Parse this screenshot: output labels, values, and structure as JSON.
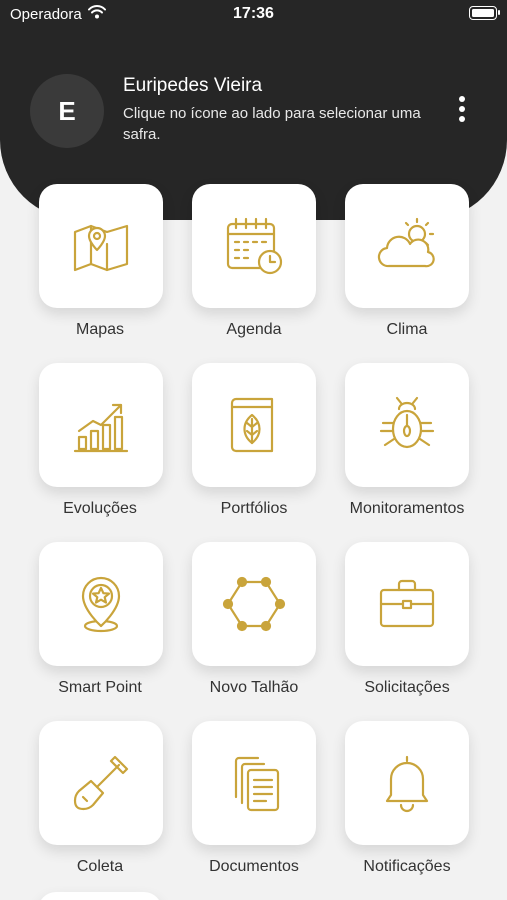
{
  "status_bar": {
    "carrier": "Operadora",
    "time": "17:36",
    "icons": [
      "wifi-icon",
      "battery-icon"
    ]
  },
  "header": {
    "avatar_initial": "E",
    "user_name": "Euripedes Vieira",
    "hint": "Clique no ícone ao lado para selecionar uma safra.",
    "menu_icon": "more-vertical-icon"
  },
  "accent_color": "#C9A43B",
  "menu": [
    {
      "label": "Mapas",
      "icon": "map-pin-icon"
    },
    {
      "label": "Agenda",
      "icon": "calendar-clock-icon"
    },
    {
      "label": "Clima",
      "icon": "weather-icon"
    },
    {
      "label": "Evoluções",
      "icon": "growth-chart-icon"
    },
    {
      "label": "Portfólios",
      "icon": "leaf-book-icon"
    },
    {
      "label": "Monitoramentos",
      "icon": "bug-icon"
    },
    {
      "label": "Smart Point",
      "icon": "star-pin-icon"
    },
    {
      "label": "Novo Talhão",
      "icon": "hexagon-icon"
    },
    {
      "label": "Solicitações",
      "icon": "briefcase-icon"
    },
    {
      "label": "Coleta",
      "icon": "shovel-icon"
    },
    {
      "label": "Documentos",
      "icon": "documents-icon"
    },
    {
      "label": "Notificações",
      "icon": "bell-icon"
    }
  ]
}
